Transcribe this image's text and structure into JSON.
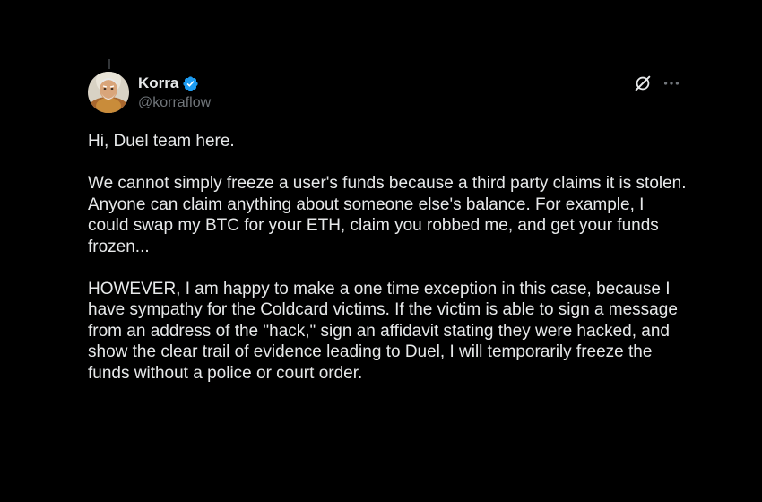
{
  "author": {
    "display_name": "Korra",
    "handle": "@korraflow",
    "verified": true,
    "avatar_icon": "avatar-image"
  },
  "actions": {
    "grok_icon": "grok-icon",
    "more_icon": "more-icon"
  },
  "tweet": {
    "paragraphs": [
      "Hi, Duel team here.",
      "We cannot simply freeze a user's funds because a third party claims it is stolen. Anyone can claim anything about someone else's balance. For example, I could swap my BTC for your ETH, claim you robbed me, and get your funds frozen...",
      "HOWEVER, I am happy to make a one time exception in this case, because I have sympathy for the Coldcard victims. If the victim is able to sign a message from an address of the \"hack,\" sign an affidavit stating they were hacked, and show the clear trail of evidence leading to Duel, I will temporarily freeze the funds without a police or court order."
    ]
  },
  "colors": {
    "background": "#000000",
    "text": "#e7e9ea",
    "secondary": "#71767b",
    "verified": "#1d9bf0"
  }
}
